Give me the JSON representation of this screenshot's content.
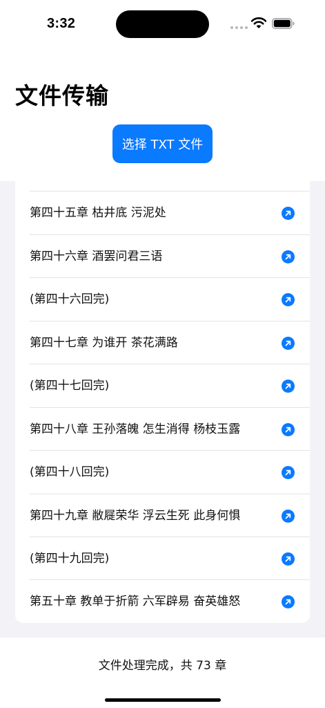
{
  "status_bar": {
    "time": "3:32"
  },
  "header": {
    "title": "文件传输"
  },
  "actions": {
    "select_button_label": "选择 TXT 文件"
  },
  "chapters": [
    {
      "label": "第四十五章 枯井底 污泥处"
    },
    {
      "label": "第四十六章 酒罢问君三语"
    },
    {
      "label": "(第四十六回完)"
    },
    {
      "label": "第四十七章 为谁开 茶花满路"
    },
    {
      "label": "(第四十七回完)"
    },
    {
      "label": "第四十八章 王孙落魄 怎生消得 杨枝玉露"
    },
    {
      "label": "(第四十八回完)"
    },
    {
      "label": "第四十九章 敝屣荣华 浮云生死 此身何惧"
    },
    {
      "label": "(第四十九回完)"
    },
    {
      "label": "第五十章 教单于折箭 六军辟易 奋英雄怒"
    }
  ],
  "footer": {
    "status_text": "文件处理完成，共 73 章"
  },
  "colors": {
    "accent": "#0a7aff",
    "list_background": "#f2f2f7"
  }
}
